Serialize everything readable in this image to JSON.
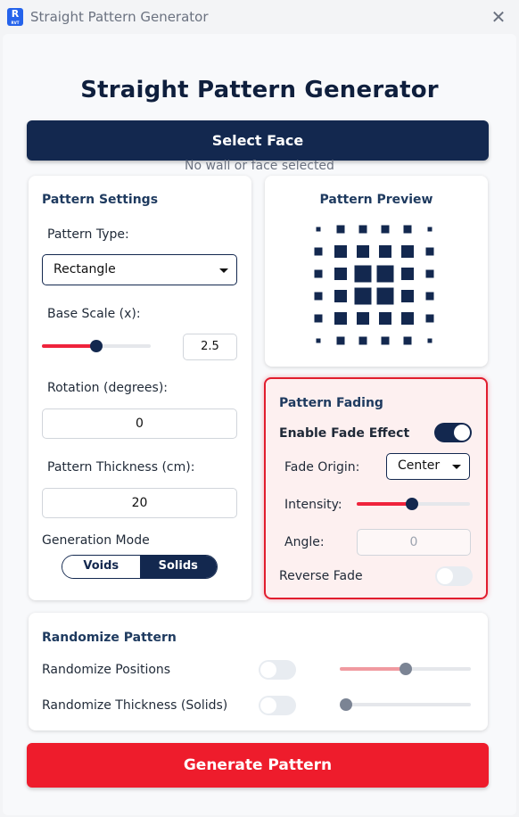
{
  "window": {
    "title": "Straight Pattern Generator",
    "icon_letter": "R",
    "icon_sub": "RVT"
  },
  "colors": {
    "navy": "#13284f",
    "accent_red": "#ee1c2c",
    "fade_border": "#e11d2e"
  },
  "header": {
    "title": "Straight Pattern Generator"
  },
  "select_face": {
    "label": "Select Face",
    "status": "No wall or face selected"
  },
  "settings": {
    "title": "Pattern Settings",
    "pattern_type_label": "Pattern Type:",
    "pattern_type_value": "Rectangle",
    "base_scale_label": "Base Scale (x):",
    "base_scale_value": "2.5",
    "base_scale_fraction": 0.5,
    "rotation_label": "Rotation (degrees):",
    "rotation_value": "0",
    "thickness_label": "Pattern Thickness (cm):",
    "thickness_value": "20",
    "mode_label": "Generation Mode",
    "mode_options": [
      "Voids",
      "Solids"
    ],
    "mode_selected": "Solids"
  },
  "preview": {
    "title": "Pattern Preview",
    "grid": [
      [
        1,
        2,
        2,
        2,
        2,
        1
      ],
      [
        2,
        3,
        3,
        3,
        3,
        2
      ],
      [
        2,
        3,
        4,
        4,
        3,
        2
      ],
      [
        2,
        3,
        4,
        4,
        3,
        2
      ],
      [
        2,
        3,
        3,
        3,
        3,
        2
      ],
      [
        1,
        2,
        2,
        2,
        2,
        1
      ]
    ]
  },
  "fading": {
    "title": "Pattern Fading",
    "enable_label": "Enable Fade Effect",
    "enable_on": true,
    "origin_label": "Fade Origin:",
    "origin_value": "Center",
    "intensity_label": "Intensity:",
    "intensity_fraction": 0.49,
    "angle_label": "Angle:",
    "angle_value": "0",
    "reverse_label": "Reverse Fade",
    "reverse_on": false
  },
  "randomize": {
    "title": "Randomize Pattern",
    "positions_label": "Randomize Positions",
    "positions_on": false,
    "positions_fraction": 0.5,
    "thickness_label": "Randomize Thickness (Solids)",
    "thickness_on": false,
    "thickness_fraction": 0.0
  },
  "generate": {
    "label": "Generate Pattern"
  }
}
